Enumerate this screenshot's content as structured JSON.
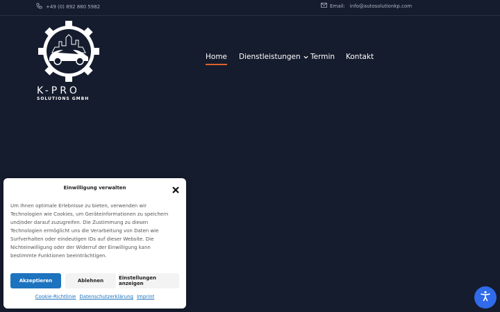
{
  "topbar": {
    "phone": "+49 (0) 892 880 5982",
    "email_label": "Email:",
    "email": "info@autosolutionkp.com",
    "phone_icon": "phone-icon",
    "email_icon": "envelope-icon"
  },
  "logo": {
    "brand": "K-PRO",
    "sub": "SOLUTIONS GMBH"
  },
  "nav": {
    "home": "Home",
    "services": "Dienstleistungen",
    "termin": "Termin",
    "kontakt": "Kontakt",
    "accent": "#e0622c"
  },
  "consent": {
    "title": "Einwilligung verwalten",
    "body": "Um Ihnen optimale Erlebnisse zu bieten, verwenden wir Technologien wie Cookies, um Geräteinformationen zu speichern und/oder darauf zuzugreifen. Die Zustimmung zu diesen Technologien ermöglicht uns die Verarbeitung von Daten wie Surfverhalten oder eindeutigen IDs auf dieser Website. Die Nichteinwilligung oder der Widerruf der Einwilligung kann bestimmte Funktionen beeinträchtigen.",
    "accept": "Akzeptieren",
    "deny": "Ablehnen",
    "settings": "Einstellungen anzeigen",
    "links": [
      "Cookie-Richtlinie",
      "Datenschutzerklärung",
      "Imprint"
    ],
    "accent": "#1e73be"
  },
  "colors": {
    "background": "#151c2d",
    "a11y_button": "#2f6bea"
  }
}
